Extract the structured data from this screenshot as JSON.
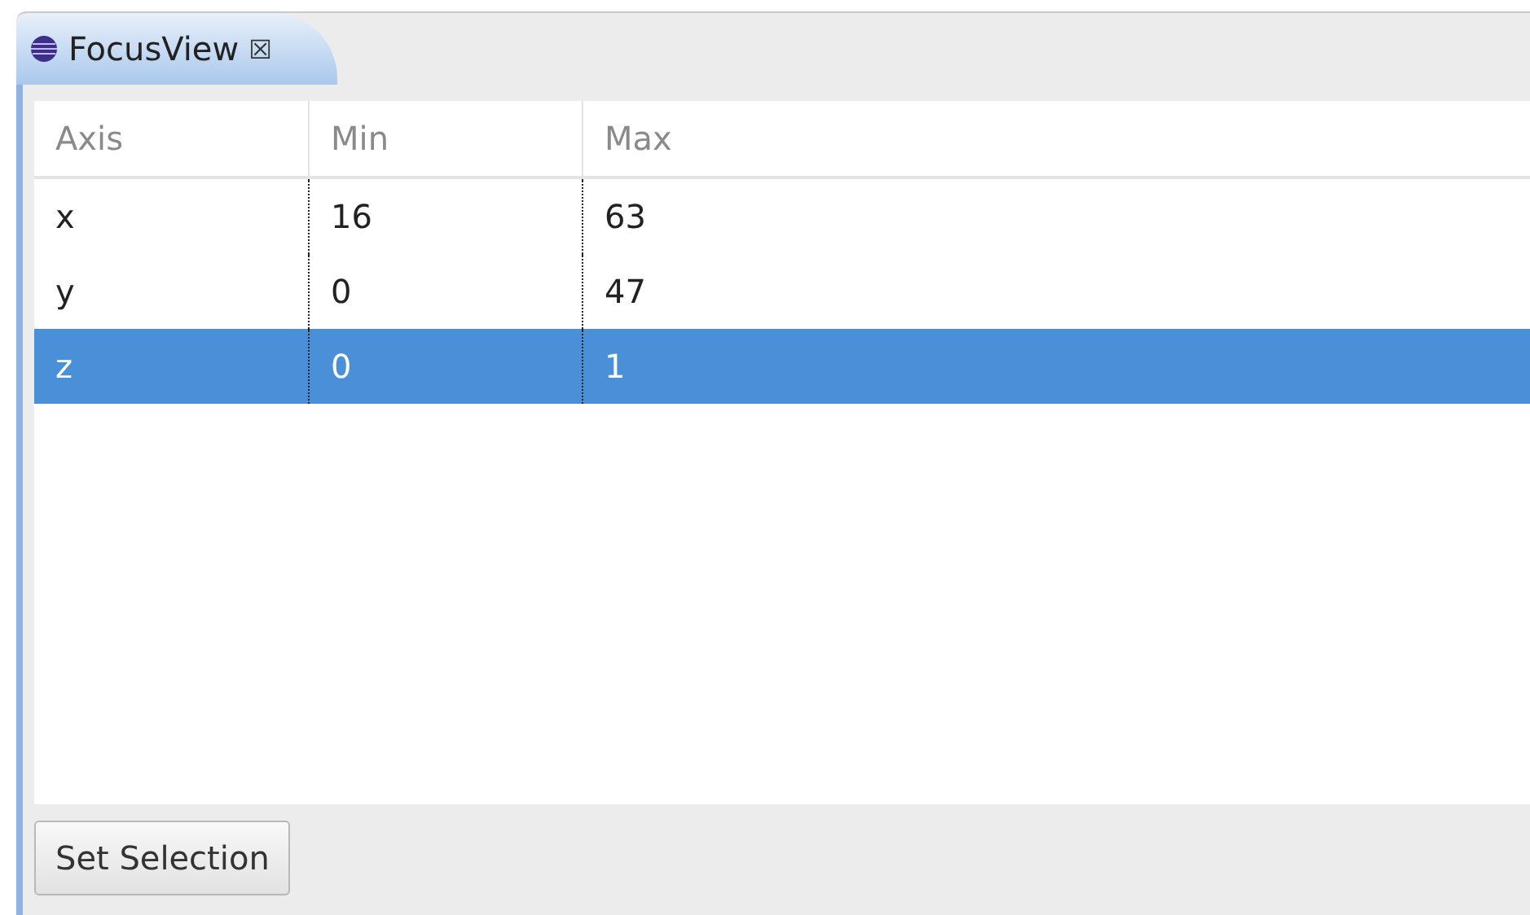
{
  "tab": {
    "title": "FocusView",
    "close": "☒",
    "selected": true
  },
  "table": {
    "columns": [
      "Axis",
      "Min",
      "Max"
    ],
    "rows": [
      {
        "cells": [
          "x",
          "16",
          "63"
        ],
        "selected": false
      },
      {
        "cells": [
          "y",
          "0",
          "47"
        ],
        "selected": false
      },
      {
        "cells": [
          "z",
          "0",
          "1"
        ],
        "selected": true
      }
    ]
  },
  "buttons": [
    "Set Selection"
  ]
}
